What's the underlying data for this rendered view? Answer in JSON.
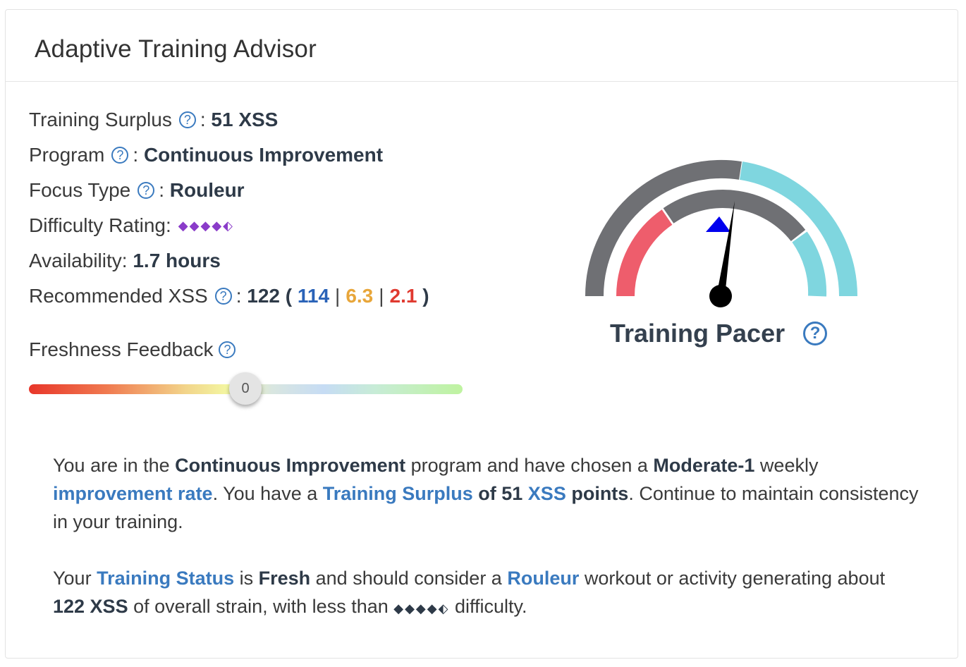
{
  "card": {
    "title": "Adaptive Training Advisor"
  },
  "stats": {
    "surplus_label": "Training Surplus",
    "surplus_value": "51 XSS",
    "program_label": "Program",
    "program_value": "Continuous Improvement",
    "focus_label": "Focus Type",
    "focus_value": "Rouleur",
    "difficulty_label": "Difficulty Rating:",
    "difficulty_value": "◆◆◆◆⬖",
    "availability_label": "Availability:",
    "availability_value": "1.7 hours",
    "recommended_label": "Recommended XSS",
    "recommended_total": "122",
    "recommended_low": "114",
    "recommended_high": "6.3",
    "recommended_peak": "2.1"
  },
  "freshness": {
    "label": "Freshness Feedback",
    "value": "0"
  },
  "pacer": {
    "title": "Training Pacer",
    "colors": {
      "grey": "#6f7074",
      "red": "#ee5d6c",
      "cyan": "#7fd6df",
      "needle": "#000000",
      "marker": "#0000ee"
    }
  },
  "summary": {
    "p1": {
      "t1": "You are in the ",
      "program": "Continuous Improvement",
      "t2": " program and have chosen a ",
      "rate_level": "Moderate-1",
      "t3": " weekly ",
      "rate_link": "improvement rate",
      "t4": ". You have a ",
      "surplus_link": "Training Surplus",
      "t5": " of 51 ",
      "xss_link": "XSS",
      "t6": " points",
      "t7": ". Continue to maintain consistency in your training."
    },
    "p2": {
      "t1": "Your ",
      "status_link": "Training Status",
      "t2": " is ",
      "status_value": "Fresh",
      "t3": " and should consider a ",
      "focus_link": "Rouleur",
      "t4": " workout or activity generating about ",
      "xss_value": "122 XSS",
      "t5": " of overall strain, with less than ",
      "diamonds": "◆◆◆◆⬖",
      "t6": " difficulty."
    }
  },
  "icons": {
    "help": "?"
  }
}
